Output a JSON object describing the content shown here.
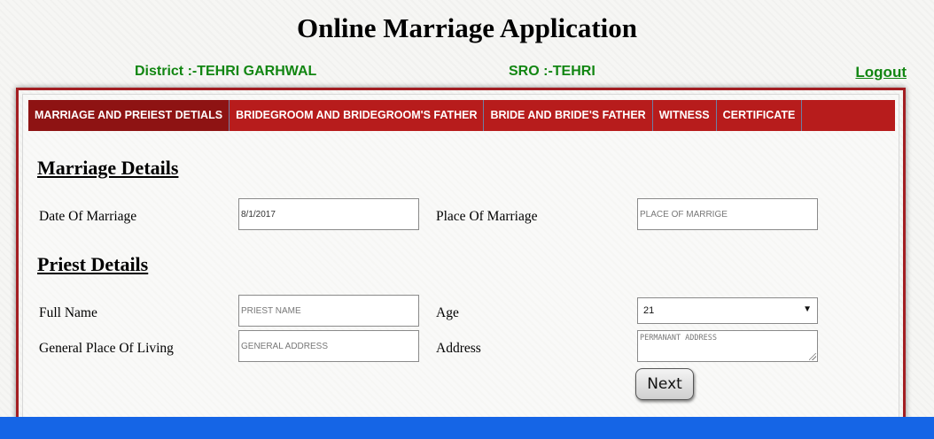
{
  "header": {
    "title": "Online Marriage Application",
    "district": "District :-TEHRI GARHWAL",
    "sro": "SRO :-TEHRI",
    "logout_label": "Logout"
  },
  "tabs": [
    {
      "label": "MARRIAGE AND PREIEST DETIALS",
      "active": true
    },
    {
      "label": "BRIDEGROOM AND BRIDEGROOM'S FATHER",
      "active": false
    },
    {
      "label": "BRIDE AND BRIDE'S FATHER",
      "active": false
    },
    {
      "label": "WITNESS",
      "active": false
    },
    {
      "label": "CERTIFICATE",
      "active": false
    }
  ],
  "marriage_details": {
    "heading": "Marriage Details",
    "date_label": "Date Of Marriage",
    "date_value": "8/1/2017",
    "place_label": "Place Of Marriage",
    "place_placeholder": "PLACE OF MARRIGE"
  },
  "priest_details": {
    "heading": "Priest Details",
    "full_name_label": "Full Name",
    "full_name_placeholder": "PRIEST NAME",
    "age_label": "Age",
    "age_value": "21",
    "general_place_label": "General Place Of Living",
    "general_place_placeholder": "GENERAL ADDRESS",
    "address_label": "Address",
    "address_placeholder": "PERMANANT ADDRESS"
  },
  "actions": {
    "next_label": "Next"
  },
  "colors": {
    "tab_bar": "#b71c1c",
    "active_tab": "#8e1313",
    "header_green": "#128612",
    "bottom_bar": "#1565e6"
  }
}
